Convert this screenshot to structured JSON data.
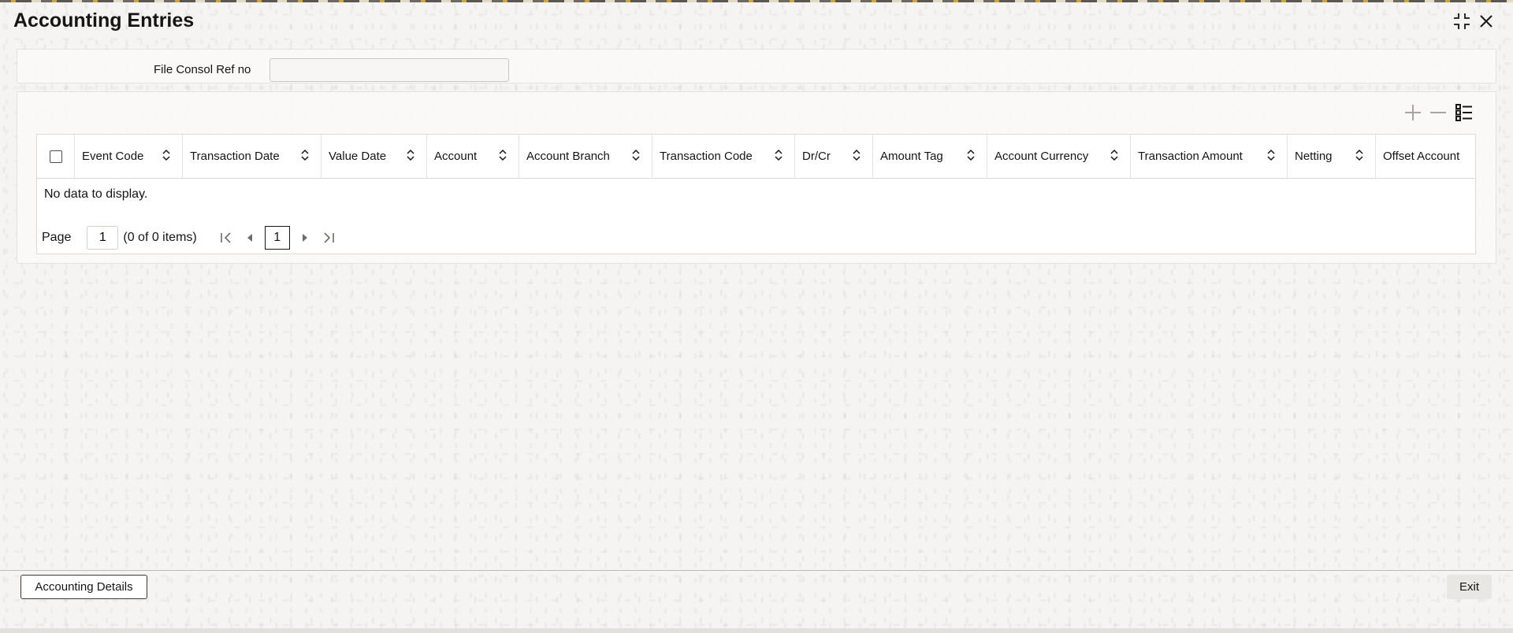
{
  "window": {
    "title": "Accounting Entries",
    "icons": [
      "minimize-icon",
      "close-icon"
    ]
  },
  "header": {
    "field_label": "File Consol Ref no",
    "field_value": ""
  },
  "grid": {
    "toolbar_icons": [
      "add-row-icon",
      "delete-row-icon",
      "single-view-icon"
    ],
    "columns": [
      "Event Code",
      "Transaction Date",
      "Value Date",
      "Account",
      "Account Branch",
      "Transaction Code",
      "Dr/Cr",
      "Amount Tag",
      "Account Currency",
      "Transaction Amount",
      "Netting",
      "Offset Account"
    ],
    "empty_message": "No data to display.",
    "pager": {
      "label": "Page",
      "page_value": "1",
      "items_text": "(0 of 0 items)",
      "current_page": "1"
    }
  },
  "footer": {
    "accounting_details_label": "Accounting Details",
    "exit_label": "Exit"
  }
}
